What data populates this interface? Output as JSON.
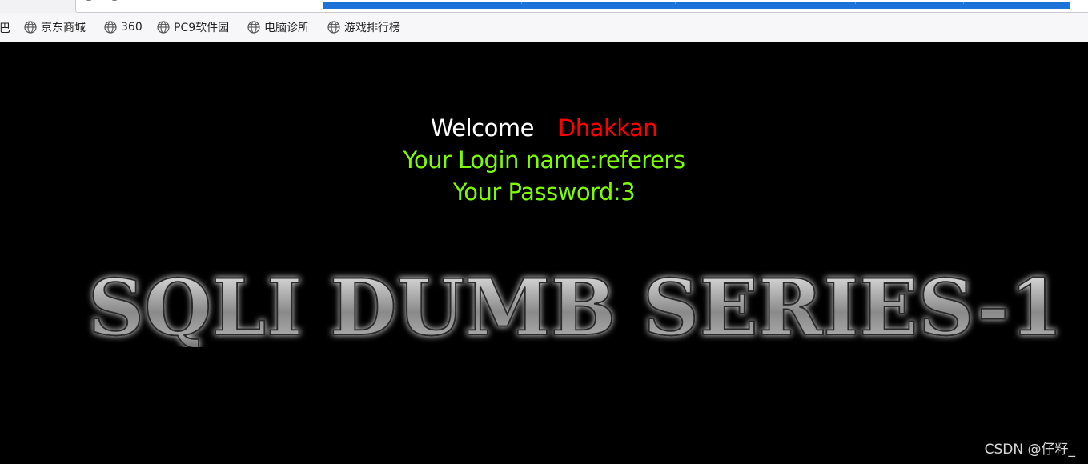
{
  "bookmarks_bar": {
    "cut_item": "巴",
    "items": [
      {
        "label": "京东商城",
        "icon": "globe-icon"
      },
      {
        "label": "360",
        "icon": "globe-icon"
      },
      {
        "label": "PC9软件园",
        "icon": "globe-icon"
      },
      {
        "label": "电脑诊所",
        "icon": "globe-icon"
      },
      {
        "label": "游戏排行榜",
        "icon": "globe-icon"
      }
    ]
  },
  "page": {
    "welcome_label": "Welcome",
    "welcome_name": "Dhakkan",
    "login_line": "Your Login name:referers",
    "password_line": "Your Password:3",
    "banner_text": "SQLI DUMB SERIES-1",
    "colors": {
      "background": "#000000",
      "welcome": "#ffffff",
      "name": "#ff0000",
      "info": "#7cfc00"
    }
  },
  "watermark": "CSDN @仔籽_"
}
